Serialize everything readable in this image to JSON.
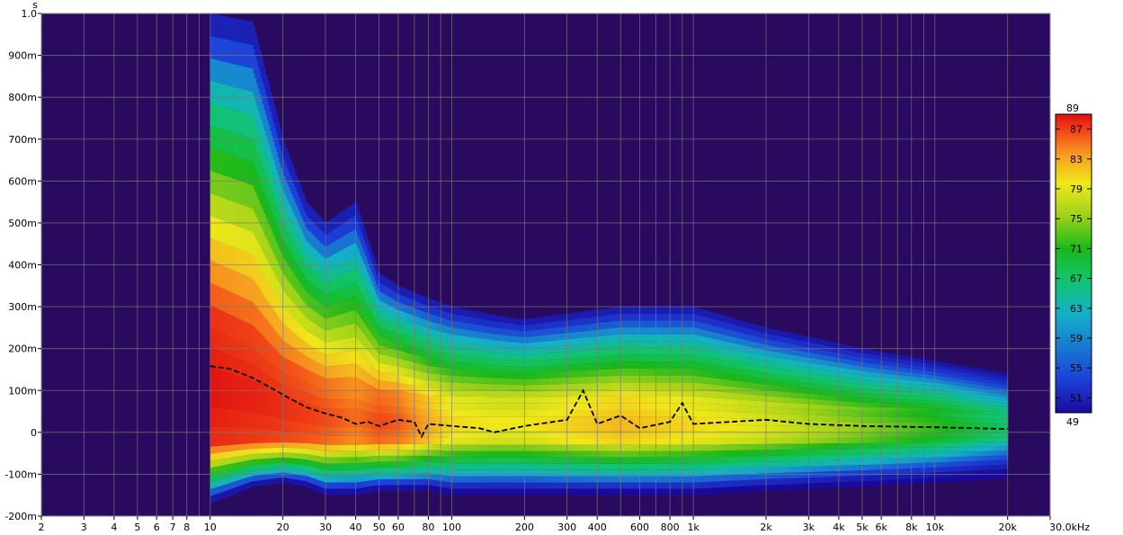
{
  "chart_data": {
    "type": "heatmap",
    "title": "",
    "subtitle": "",
    "xlabel": "",
    "ylabel": "s",
    "x_scale": "log",
    "xlim": [
      2,
      30000
    ],
    "ylim": [
      -0.2,
      1.0
    ],
    "grid": true,
    "x_ticks": [
      {
        "value": 2,
        "label": "2"
      },
      {
        "value": 3,
        "label": "3"
      },
      {
        "value": 4,
        "label": "4"
      },
      {
        "value": 5,
        "label": "5"
      },
      {
        "value": 6,
        "label": "6"
      },
      {
        "value": 7,
        "label": "7"
      },
      {
        "value": 8,
        "label": "8"
      },
      {
        "value": 10,
        "label": "10"
      },
      {
        "value": 20,
        "label": "20"
      },
      {
        "value": 30,
        "label": "30"
      },
      {
        "value": 40,
        "label": "40"
      },
      {
        "value": 50,
        "label": "50"
      },
      {
        "value": 60,
        "label": "60"
      },
      {
        "value": 80,
        "label": "80"
      },
      {
        "value": 100,
        "label": "100"
      },
      {
        "value": 200,
        "label": "200"
      },
      {
        "value": 300,
        "label": "300"
      },
      {
        "value": 400,
        "label": "400"
      },
      {
        "value": 600,
        "label": "600"
      },
      {
        "value": 800,
        "label": "800"
      },
      {
        "value": 1000,
        "label": "1k"
      },
      {
        "value": 2000,
        "label": "2k"
      },
      {
        "value": 3000,
        "label": "3k"
      },
      {
        "value": 4000,
        "label": "4k"
      },
      {
        "value": 5000,
        "label": "5k"
      },
      {
        "value": 6000,
        "label": "6k"
      },
      {
        "value": 8000,
        "label": "8k"
      },
      {
        "value": 10000,
        "label": "10k"
      },
      {
        "value": 20000,
        "label": "20k"
      },
      {
        "value": 30000,
        "label": "30.0kHz"
      }
    ],
    "y_ticks": [
      {
        "value": 1.0,
        "label": "1.0"
      },
      {
        "value": 0.9,
        "label": "900m"
      },
      {
        "value": 0.8,
        "label": "800m"
      },
      {
        "value": 0.7,
        "label": "700m"
      },
      {
        "value": 0.6,
        "label": "600m"
      },
      {
        "value": 0.5,
        "label": "500m"
      },
      {
        "value": 0.4,
        "label": "400m"
      },
      {
        "value": 0.3,
        "label": "300m"
      },
      {
        "value": 0.2,
        "label": "200m"
      },
      {
        "value": 0.1,
        "label": "100m"
      },
      {
        "value": 0.0,
        "label": "0"
      },
      {
        "value": -0.1,
        "label": "-100m"
      },
      {
        "value": -0.2,
        "label": "-200m"
      }
    ],
    "colorbar": {
      "min": 49,
      "max": 89,
      "ticks": [
        {
          "value": 89,
          "label": "89"
        },
        {
          "value": 87,
          "label": "87"
        },
        {
          "value": 83,
          "label": "83"
        },
        {
          "value": 79,
          "label": "79"
        },
        {
          "value": 75,
          "label": "75"
        },
        {
          "value": 71,
          "label": "71"
        },
        {
          "value": 67,
          "label": "67"
        },
        {
          "value": 63,
          "label": "63"
        },
        {
          "value": 59,
          "label": "59"
        },
        {
          "value": 55,
          "label": "55"
        },
        {
          "value": 51,
          "label": "51"
        },
        {
          "value": 49,
          "label": "49"
        }
      ],
      "colors": [
        "#1a0a9c",
        "#1d40d8",
        "#14b0c8",
        "#12c46a",
        "#1ab81a",
        "#9ed21a",
        "#f0e81a",
        "#f7a020",
        "#f24a18",
        "#e01010"
      ]
    },
    "background_color": "#2a0a5e",
    "peak_time_curve": {
      "name": "",
      "style": "dashed",
      "color": "#000000",
      "x": [
        10,
        12,
        15,
        18,
        20,
        25,
        30,
        35,
        40,
        45,
        50,
        60,
        70,
        75,
        80,
        100,
        130,
        150,
        200,
        300,
        350,
        400,
        500,
        600,
        800,
        900,
        1000,
        2000,
        3000,
        5000,
        10000,
        20000
      ],
      "y": [
        0.158,
        0.152,
        0.13,
        0.105,
        0.09,
        0.06,
        0.045,
        0.035,
        0.02,
        0.025,
        0.015,
        0.03,
        0.025,
        -0.01,
        0.02,
        0.015,
        0.01,
        0.0,
        0.015,
        0.03,
        0.1,
        0.02,
        0.04,
        0.01,
        0.025,
        0.07,
        0.02,
        0.03,
        0.02,
        0.015,
        0.012,
        0.008
      ]
    },
    "energy_envelope": {
      "x": [
        10,
        15,
        20,
        25,
        30,
        40,
        50,
        60,
        80,
        100,
        150,
        200,
        500,
        1000,
        2000,
        5000,
        10000,
        20000
      ],
      "upper_extent": [
        1.0,
        0.98,
        0.7,
        0.55,
        0.5,
        0.55,
        0.38,
        0.35,
        0.32,
        0.3,
        0.28,
        0.27,
        0.3,
        0.3,
        0.25,
        0.2,
        0.17,
        0.14
      ],
      "core_extent": [
        0.25,
        0.2,
        0.14,
        0.12,
        0.1,
        0.1,
        0.08,
        0.08,
        0.07,
        0.07,
        0.07,
        0.07,
        0.07,
        0.07,
        0.06,
        0.05,
        0.05,
        0.04
      ],
      "lower_extent": [
        -0.17,
        -0.13,
        -0.12,
        -0.13,
        -0.15,
        -0.15,
        -0.14,
        -0.14,
        -0.14,
        -0.15,
        -0.15,
        -0.15,
        -0.15,
        -0.15,
        -0.14,
        -0.13,
        -0.12,
        -0.11
      ],
      "peak_level": [
        89,
        88,
        87,
        86,
        85,
        83,
        85,
        84,
        80,
        77,
        76,
        76,
        79,
        77,
        75,
        71,
        68,
        63
      ]
    }
  }
}
